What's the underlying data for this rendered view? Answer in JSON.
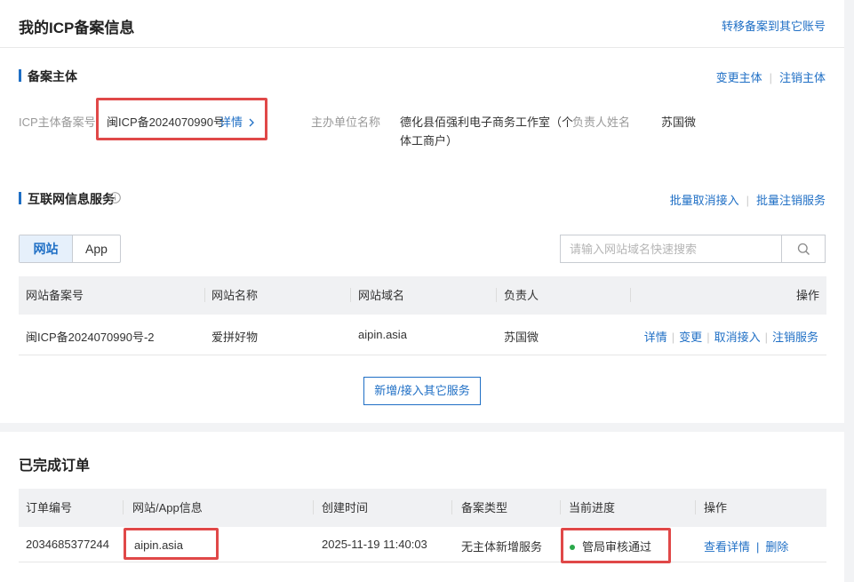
{
  "header": {
    "title": "我的ICP备案信息",
    "transfer_link": "转移备案到其它账号"
  },
  "subject": {
    "title": "备案主体",
    "change_link": "变更主体",
    "cancel_link": "注销主体",
    "icp_label": "ICP主体备案号",
    "icp_value": "闽ICP备2024070990号",
    "detail_link": "详情",
    "org_label": "主办单位名称",
    "org_value_line1": "德化县佰强利电子商务工作室（个",
    "org_value_line2": "体工商户）",
    "owner_label": "负责人姓名",
    "owner_value": "苏国微"
  },
  "services": {
    "title": "互联网信息服务",
    "batch_cancel_access": "批量取消接入",
    "batch_cancel_service": "批量注销服务",
    "tabs": [
      {
        "label": "网站",
        "active": true
      },
      {
        "label": "App",
        "active": false
      }
    ],
    "search_placeholder": "请输入网站域名快速搜索",
    "columns": [
      "网站备案号",
      "网站名称",
      "网站域名",
      "负责人",
      "操作"
    ],
    "rows": [
      {
        "record_no": "闽ICP备2024070990号-2",
        "site_name": "爱拼好物",
        "domain": "aipin.asia",
        "owner": "苏国微",
        "actions": [
          "详情",
          "变更",
          "取消接入",
          "注销服务"
        ]
      }
    ],
    "add_button": "新增/接入其它服务"
  },
  "orders": {
    "title": "已完成订单",
    "columns": [
      "订单编号",
      "网站/App信息",
      "创建时间",
      "备案类型",
      "当前进度",
      "操作"
    ],
    "rows": [
      {
        "order_no": "2034685377244",
        "site_info": "aipin.asia",
        "created": "2025-11-19 11:40:03",
        "type": "无主体新增服务",
        "progress": "管局审核通过",
        "actions": [
          "查看详情",
          "删除"
        ]
      }
    ]
  },
  "colors": {
    "accent": "#1f6fc5",
    "highlight_box": "#e04848",
    "status_dot": "#2aa84a"
  }
}
